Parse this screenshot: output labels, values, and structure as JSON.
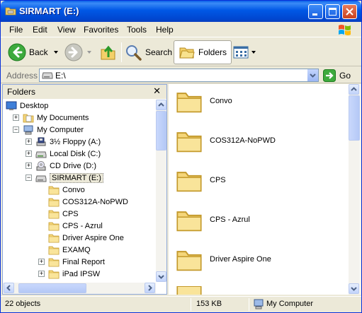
{
  "window": {
    "title": "SIRMART (E:)"
  },
  "menu": [
    "File",
    "Edit",
    "View",
    "Favorites",
    "Tools",
    "Help"
  ],
  "menu_underline": [
    "F",
    "E",
    "V",
    "a",
    "T",
    "H"
  ],
  "toolbar": {
    "back_label": "Back",
    "search_label": "Search",
    "folders_label": "Folders"
  },
  "address": {
    "label": "Address",
    "value": "E:\\",
    "go_label": "Go"
  },
  "folders_pane": {
    "title": "Folders",
    "tree": [
      {
        "label": "Desktop",
        "icon": "desktop-icon",
        "level": 0,
        "expander": ""
      },
      {
        "label": "My Documents",
        "icon": "my-documents-icon",
        "level": 1,
        "expander": "+"
      },
      {
        "label": "My Computer",
        "icon": "my-computer-icon",
        "level": 1,
        "expander": "-"
      },
      {
        "label": "3½ Floppy (A:)",
        "icon": "floppy-drive-icon",
        "level": 2,
        "expander": "+"
      },
      {
        "label": "Local Disk (C:)",
        "icon": "hard-drive-icon",
        "level": 2,
        "expander": "+"
      },
      {
        "label": "CD Drive (D:)",
        "icon": "cd-drive-icon",
        "level": 2,
        "expander": "+"
      },
      {
        "label": "SIRMART (E:)",
        "icon": "removable-drive-icon",
        "level": 2,
        "expander": "-",
        "selected": true
      },
      {
        "label": "Convo",
        "icon": "folder-icon",
        "level": 3,
        "expander": ""
      },
      {
        "label": "COS312A-NoPWD",
        "icon": "folder-icon",
        "level": 3,
        "expander": ""
      },
      {
        "label": "CPS",
        "icon": "folder-icon",
        "level": 3,
        "expander": ""
      },
      {
        "label": "CPS - Azrul",
        "icon": "folder-icon",
        "level": 3,
        "expander": ""
      },
      {
        "label": "Driver Aspire One",
        "icon": "folder-icon",
        "level": 3,
        "expander": ""
      },
      {
        "label": "EXAMQ",
        "icon": "folder-icon",
        "level": 3,
        "expander": ""
      },
      {
        "label": "Final Report",
        "icon": "folder-icon",
        "level": 3,
        "expander": "+"
      },
      {
        "label": "iPad IPSW",
        "icon": "folder-icon",
        "level": 3,
        "expander": "+"
      }
    ]
  },
  "content": {
    "items": [
      {
        "name": "Convo"
      },
      {
        "name": "COS312A-NoPWD"
      },
      {
        "name": "CPS"
      },
      {
        "name": "CPS - Azrul"
      },
      {
        "name": "Driver Aspire One"
      }
    ]
  },
  "status": {
    "objects": "22 objects",
    "size": "153 KB",
    "location": "My Computer"
  },
  "colors": {
    "titlebar": "#0058E6",
    "folder": "#F5D67A",
    "selection": "#ECE9D8"
  }
}
